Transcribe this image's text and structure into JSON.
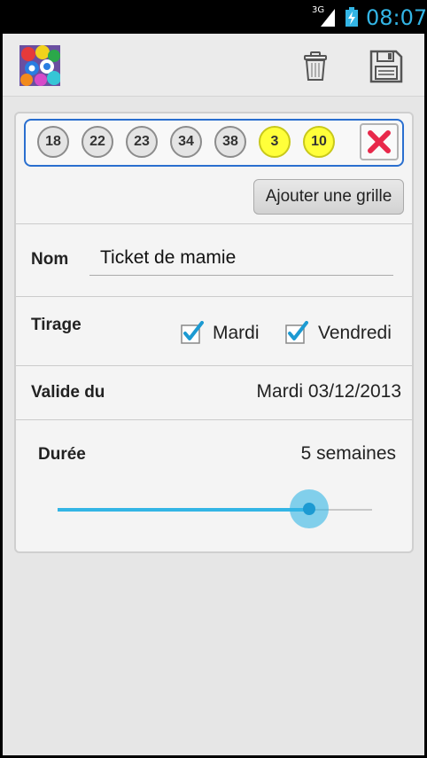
{
  "status_bar": {
    "network": "3G",
    "time": "08:07"
  },
  "action_bar": {
    "app_icon": "lottery-balls-icon",
    "actions": [
      "trash-icon",
      "save-icon"
    ]
  },
  "grid": {
    "numbers": [
      "18",
      "22",
      "23",
      "34",
      "38"
    ],
    "stars": [
      "3",
      "10"
    ],
    "delete_icon": "close-icon"
  },
  "add_grid_label": "Ajouter une grille",
  "form": {
    "name_label": "Nom",
    "name_value": "Ticket de mamie",
    "draw_label": "Tirage",
    "tuesday_label": "Mardi",
    "tuesday_checked": true,
    "friday_label": "Vendredi",
    "friday_checked": true,
    "valid_from_label": "Valide du",
    "valid_from_value": "Mardi 03/12/2013",
    "duration_label": "Durée",
    "duration_value": "5 semaines",
    "duration_slider_fraction": 0.8
  },
  "colors": {
    "accent": "#33b5e5",
    "selected_border": "#2a6fcf",
    "star_ball": "#ffff3a",
    "delete_red": "#e8284a"
  }
}
